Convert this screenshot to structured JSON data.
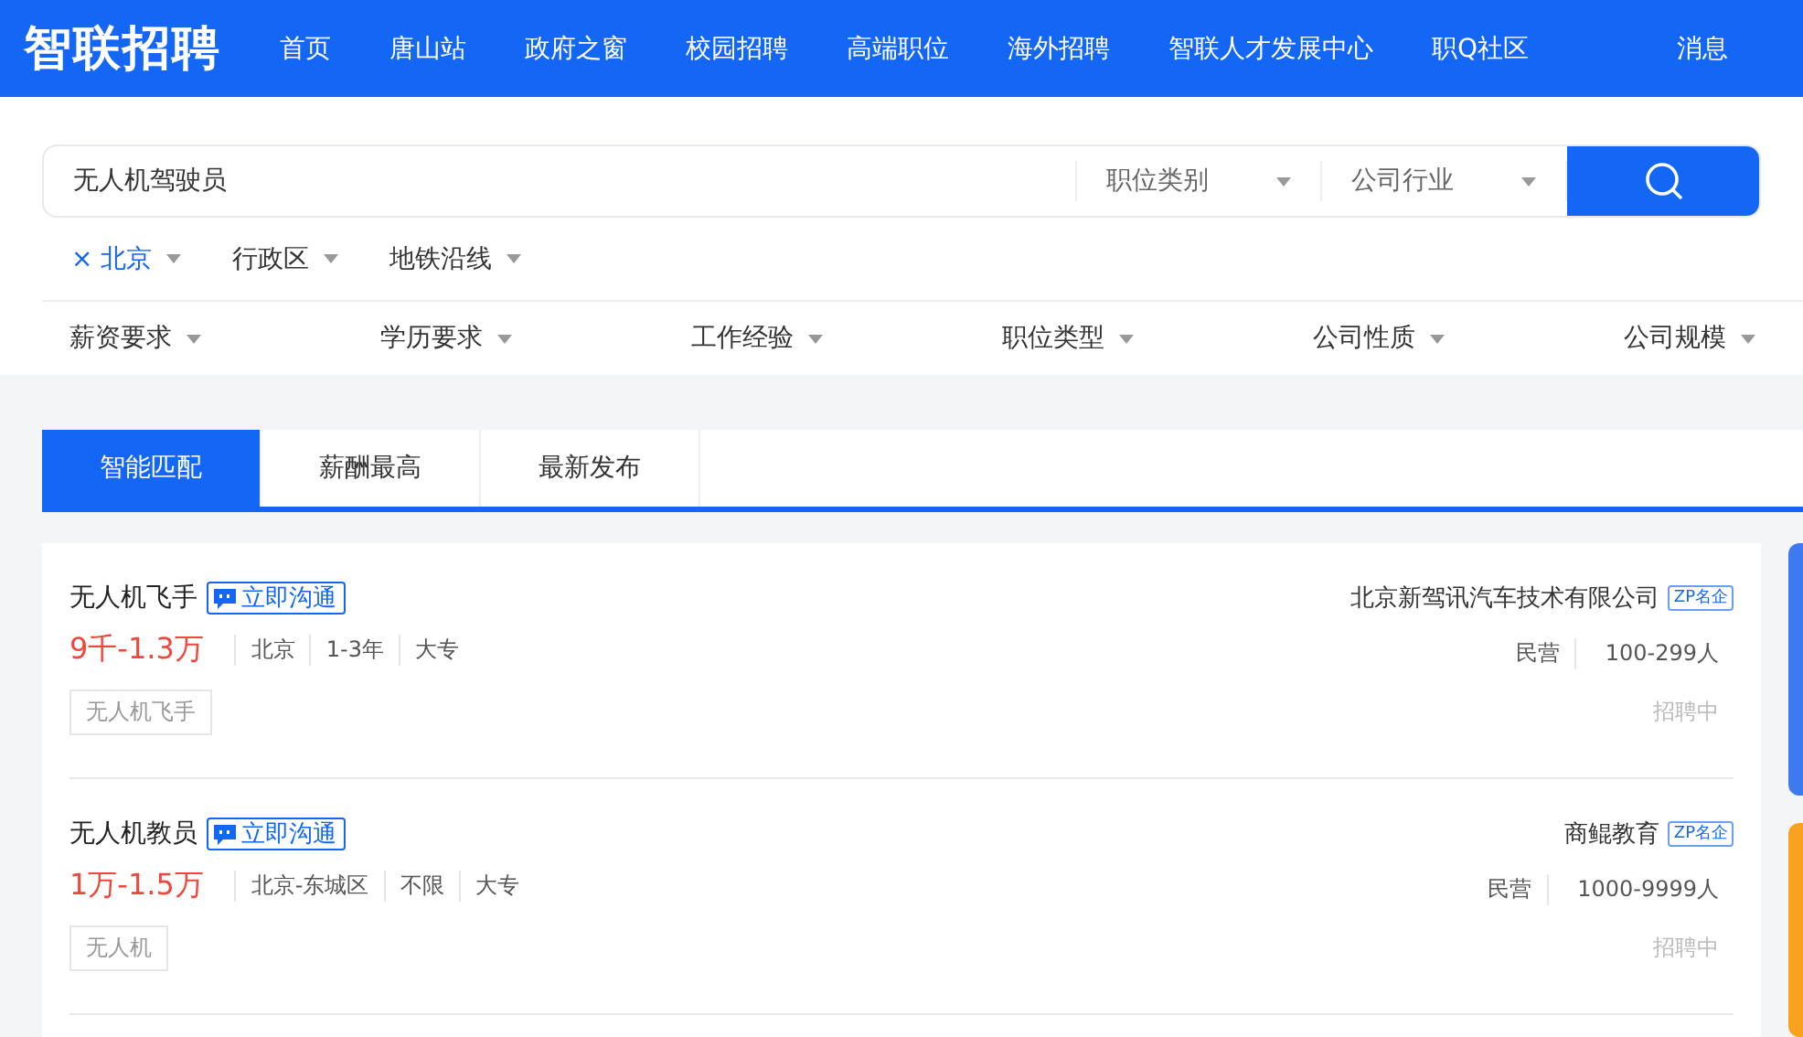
{
  "header": {
    "logo": "智联招聘",
    "nav": [
      "首页",
      "唐山站",
      "政府之窗",
      "校园招聘",
      "高端职位",
      "海外招聘",
      "智联人才发展中心",
      "职Q社区"
    ],
    "messages": "消息"
  },
  "search": {
    "query": "无人机驾驶员",
    "dropdowns": [
      "职位类别",
      "公司行业"
    ]
  },
  "location_filters": [
    {
      "label": "北京",
      "selected": true,
      "clear_mark": "×"
    },
    {
      "label": "行政区",
      "selected": false
    },
    {
      "label": "地铁沿线",
      "selected": false
    }
  ],
  "filters": [
    "薪资要求",
    "学历要求",
    "工作经验",
    "职位类型",
    "公司性质",
    "公司规模"
  ],
  "tabs": [
    {
      "label": "智能匹配",
      "selected": true
    },
    {
      "label": "薪酬最高",
      "selected": false
    },
    {
      "label": "最新发布",
      "selected": false
    }
  ],
  "jobs": [
    {
      "title": "无人机飞手",
      "chat": "立即沟通",
      "salary": "9千-1.3万",
      "meta": [
        "北京",
        "1-3年",
        "大专"
      ],
      "tags": [
        "无人机飞手"
      ],
      "company": "北京新驾讯汽车技术有限公司",
      "company_badge": "ZP名企",
      "company_meta": [
        "民营",
        "100-299人"
      ],
      "status": "招聘中"
    },
    {
      "title": "无人机教员",
      "chat": "立即沟通",
      "salary": "1万-1.5万",
      "meta": [
        "北京-东城区",
        "不限",
        "大专"
      ],
      "tags": [
        "无人机"
      ],
      "company": "商鲲教育",
      "company_badge": "ZP名企",
      "company_meta": [
        "民营",
        "1000-9999人"
      ],
      "status": "招聘中"
    }
  ]
}
